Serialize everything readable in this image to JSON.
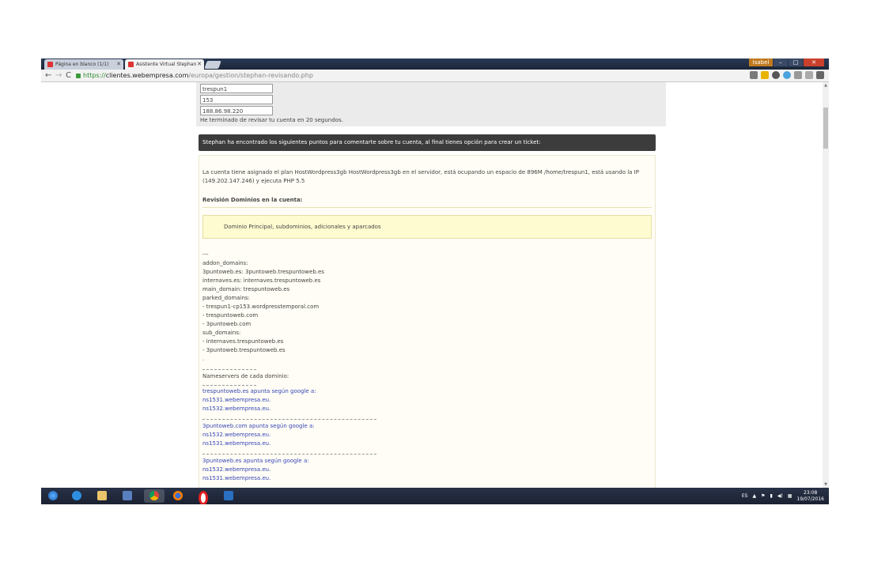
{
  "browser": {
    "tabs": [
      {
        "label": "Página en blanco (1/1)",
        "active": false
      },
      {
        "label": "Asistente Virtual Stephan",
        "active": true
      }
    ],
    "url_secure": "https://",
    "url_host": "clientes.webempresa.com",
    "url_path": "/europa/gestion/stephan-revisando.php",
    "user_badge": "Isabel"
  },
  "page": {
    "fields": [
      "trespun1",
      "153",
      "188.86.98.220"
    ],
    "review_done": "He terminado de revisar tu cuenta en 20 segundos.",
    "banner": "Stephan ha encontrado los siguientes puntos para comentarte sobre tu cuenta, al final tienes opción para crear un ticket:",
    "plan_text": "La cuenta tiene asignado el plan HostWordpress3gb HostWordpress3gb en el servidor, está ocupando un espacio de 896M /home/trespun1, está usando la IP (149.202.147.246) y ejecuta PHP 5.5",
    "domains_heading": "Revisión Dominios en la cuenta:",
    "domains_box": "Dominio Principal, subdominios, adicionales y aparcados",
    "raw_lines": [
      "---",
      "addon_domains:",
      "3puntoweb.es: 3puntoweb.trespuntoweb.es",
      "internaves.es: internaves.trespuntoweb.es",
      "main_domain: trespuntoweb.es",
      "parked_domains:",
      "- trespun1-cp153.wordpresstemporal.com",
      "- trespuntoweb.com",
      "- 3puntoweb.com",
      "sub_domains:",
      "- internaves.trespuntoweb.es",
      "- 3puntoweb.trespuntoweb.es",
      "."
    ],
    "ns_title": "Nameservers de cada dominio:",
    "ns_groups": [
      {
        "title": "trespuntoweb.es apunta según google a:",
        "ns": [
          "ns1531.webempresa.eu.",
          "ns1532.webempresa.eu."
        ]
      },
      {
        "title": "3puntoweb.com apunta según google a:",
        "ns": [
          "ns1532.webempresa.eu.",
          "ns1531.webempresa.eu."
        ]
      },
      {
        "title": "3puntoweb.es apunta según google a:",
        "ns": [
          "ns1532.webempresa.eu.",
          "ns1531.webempresa.eu."
        ]
      }
    ]
  },
  "taskbar": {
    "lang": "ES",
    "time": "23:08",
    "date": "19/07/2016",
    "icons": [
      "windows-start-icon",
      "ie-icon",
      "explorer-icon",
      "media-player-icon",
      "chrome-icon",
      "firefox-icon",
      "opera-icon",
      "outlook-icon"
    ]
  }
}
